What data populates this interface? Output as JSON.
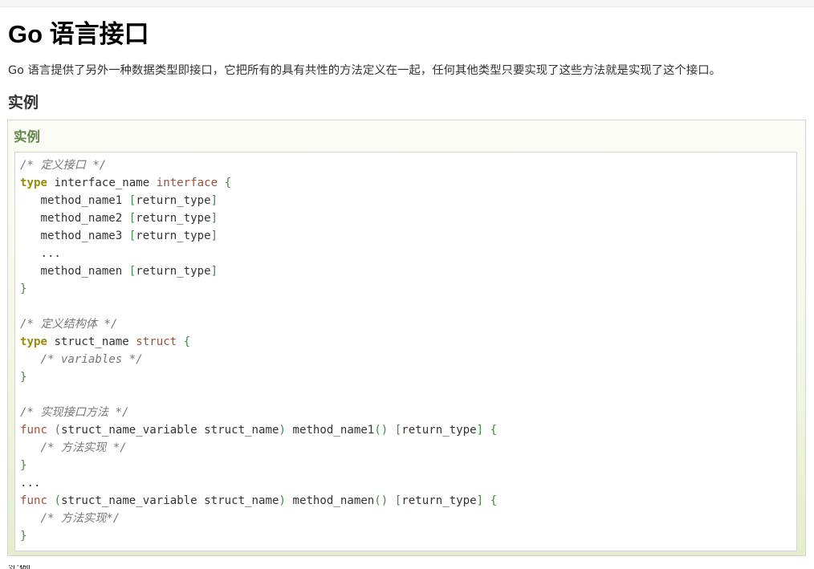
{
  "page": {
    "title": "Go 语言接口",
    "intro": "Go 语言提供了另外一种数据类型即接口，它把所有的具有共性的方法定义在一起，任何其他类型只要实现了这些方法就是实现了这个接口。",
    "section_title": "实例"
  },
  "example": {
    "title": "实例",
    "code_lines": [
      [
        {
          "t": "/* 定义接口 */",
          "c": "cm"
        }
      ],
      [
        {
          "t": "type",
          "c": "kw"
        },
        {
          "t": " interface_name ",
          "c": ""
        },
        {
          "t": "interface",
          "c": "kw2"
        },
        {
          "t": " {",
          "c": "br"
        }
      ],
      [
        {
          "t": "   method_name1 ",
          "c": ""
        },
        {
          "t": "[",
          "c": "br"
        },
        {
          "t": "return_type",
          "c": ""
        },
        {
          "t": "]",
          "c": "br"
        }
      ],
      [
        {
          "t": "   method_name2 ",
          "c": ""
        },
        {
          "t": "[",
          "c": "br"
        },
        {
          "t": "return_type",
          "c": ""
        },
        {
          "t": "]",
          "c": "br"
        }
      ],
      [
        {
          "t": "   method_name3 ",
          "c": ""
        },
        {
          "t": "[",
          "c": "br"
        },
        {
          "t": "return_type",
          "c": ""
        },
        {
          "t": "]",
          "c": "br"
        }
      ],
      [
        {
          "t": "   ...",
          "c": ""
        }
      ],
      [
        {
          "t": "   method_namen ",
          "c": ""
        },
        {
          "t": "[",
          "c": "br"
        },
        {
          "t": "return_type",
          "c": ""
        },
        {
          "t": "]",
          "c": "br"
        }
      ],
      [
        {
          "t": "}",
          "c": "br"
        }
      ],
      [],
      [
        {
          "t": "/* 定义结构体 */",
          "c": "cm"
        }
      ],
      [
        {
          "t": "type",
          "c": "kw"
        },
        {
          "t": " struct_name ",
          "c": ""
        },
        {
          "t": "struct",
          "c": "kw2"
        },
        {
          "t": " {",
          "c": "br"
        }
      ],
      [
        {
          "t": "   /* variables */",
          "c": "cm"
        }
      ],
      [
        {
          "t": "}",
          "c": "br"
        }
      ],
      [],
      [
        {
          "t": "/* 实现接口方法 */",
          "c": "cm"
        }
      ],
      [
        {
          "t": "func",
          "c": "kw2"
        },
        {
          "t": " ",
          "c": ""
        },
        {
          "t": "(",
          "c": "br"
        },
        {
          "t": "struct_name_variable struct_name",
          "c": ""
        },
        {
          "t": ")",
          "c": "br"
        },
        {
          "t": " method_name1",
          "c": ""
        },
        {
          "t": "()",
          "c": "br"
        },
        {
          "t": " ",
          "c": ""
        },
        {
          "t": "[",
          "c": "br"
        },
        {
          "t": "return_type",
          "c": ""
        },
        {
          "t": "]",
          "c": "br"
        },
        {
          "t": " {",
          "c": "br"
        }
      ],
      [
        {
          "t": "   /* 方法实现 */",
          "c": "cm"
        }
      ],
      [
        {
          "t": "}",
          "c": "br"
        }
      ],
      [
        {
          "t": "...",
          "c": ""
        }
      ],
      [
        {
          "t": "func",
          "c": "kw2"
        },
        {
          "t": " ",
          "c": ""
        },
        {
          "t": "(",
          "c": "br"
        },
        {
          "t": "struct_name_variable struct_name",
          "c": ""
        },
        {
          "t": ")",
          "c": "br"
        },
        {
          "t": " method_namen",
          "c": ""
        },
        {
          "t": "()",
          "c": "br"
        },
        {
          "t": " ",
          "c": ""
        },
        {
          "t": "[",
          "c": "br"
        },
        {
          "t": "return_type",
          "c": ""
        },
        {
          "t": "]",
          "c": "br"
        },
        {
          "t": " {",
          "c": "br"
        }
      ],
      [
        {
          "t": "   /* 方法实现*/",
          "c": "cm"
        }
      ],
      [
        {
          "t": "}",
          "c": "br"
        }
      ]
    ]
  },
  "footer": {
    "partial_text": "实例"
  },
  "colors": {
    "title": "#000000",
    "text": "#333333",
    "example_title": "#64854c",
    "keyword": "#9b8a0e",
    "keyword2": "#a04f3b",
    "bracket": "#3e8e3e",
    "comment": "#777777",
    "box_border": "#d4d4d4"
  }
}
